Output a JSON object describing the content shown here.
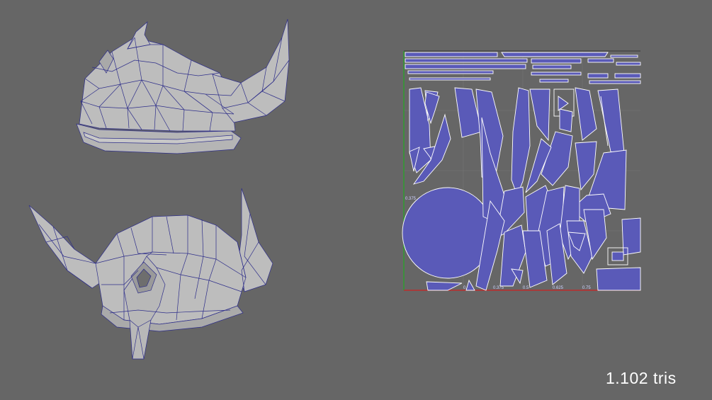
{
  "stats": {
    "triangle_count": "1.102 tris"
  },
  "uv_editor": {
    "ticks_x": [
      "0.25",
      "0.375",
      "0.5",
      "0.625",
      "0.75"
    ],
    "ticks_y": [
      "0.375"
    ]
  },
  "colors": {
    "background": "#666666",
    "mesh_fill": "#bdbdbd",
    "wireframe": "#2e2e8a",
    "uv_shell_fill": "#5a5ab8",
    "uv_edge": "#ffffff",
    "uv_axis_u": "#cc2222",
    "uv_axis_v": "#22aa22"
  }
}
